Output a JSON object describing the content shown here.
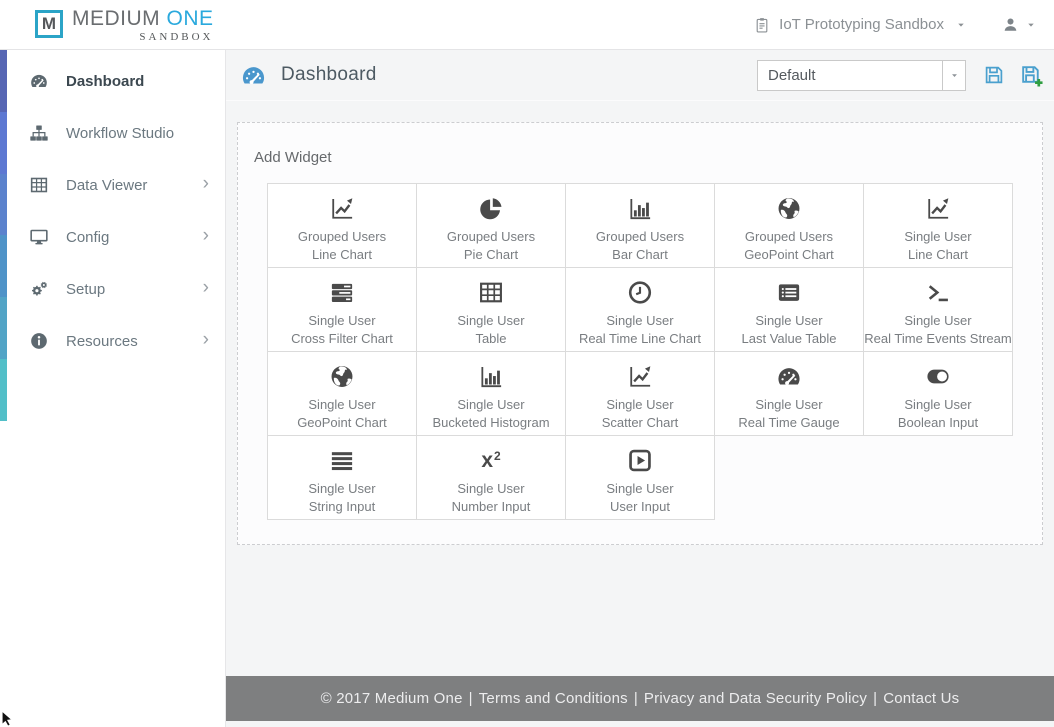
{
  "brand": {
    "mark": "M",
    "name_part1": "MEDIUM ",
    "name_part2": "ONE",
    "tagline": "SANDBOX"
  },
  "colors": {
    "brand_teal": "#2ba4c7",
    "brand_blue": "#2aa9dd",
    "header_icon_blue": "#4a97cd",
    "save_icon_blue": "#4aa0ce",
    "save_plus_green": "#2f9e41",
    "footer_bg": "#7e7f80",
    "sidebar_strip": [
      "#5766b4",
      "#5d78d2",
      "#5b82cd",
      "#4f93c8",
      "#52a4c6",
      "#52bfc8"
    ]
  },
  "top_bar": {
    "workspace_label": "IoT Prototyping Sandbox"
  },
  "sidebar": {
    "items": [
      {
        "label": "Dashboard",
        "icon": "gauge",
        "active": true,
        "chevron": false
      },
      {
        "label": "Workflow Studio",
        "icon": "sitemap",
        "active": false,
        "chevron": false
      },
      {
        "label": "Data Viewer",
        "icon": "table",
        "active": false,
        "chevron": true
      },
      {
        "label": "Config",
        "icon": "desktop",
        "active": false,
        "chevron": true
      },
      {
        "label": "Setup",
        "icon": "gears",
        "active": false,
        "chevron": true
      },
      {
        "label": "Resources",
        "icon": "info",
        "active": false,
        "chevron": true
      }
    ],
    "chevron_glyph": "›"
  },
  "main_header": {
    "title": "Dashboard",
    "preset_dropdown": {
      "value": "Default"
    }
  },
  "panel": {
    "title": "Add Widget",
    "widgets": [
      {
        "top": "Grouped Users",
        "bottom": "Line Chart",
        "icon": "line-chart"
      },
      {
        "top": "Grouped Users",
        "bottom": "Pie Chart",
        "icon": "pie-chart"
      },
      {
        "top": "Grouped Users",
        "bottom": "Bar Chart",
        "icon": "bar-chart"
      },
      {
        "top": "Grouped Users",
        "bottom": "GeoPoint Chart",
        "icon": "globe"
      },
      {
        "top": "Single User",
        "bottom": "Line Chart",
        "icon": "line-chart"
      },
      {
        "top": "Single User",
        "bottom": "Cross Filter Chart",
        "icon": "tasks"
      },
      {
        "top": "Single User",
        "bottom": "Table",
        "icon": "table-widget"
      },
      {
        "top": "Single User",
        "bottom": "Real Time Line Chart",
        "icon": "clock"
      },
      {
        "top": "Single User",
        "bottom": "Last Value Table",
        "icon": "list-alt"
      },
      {
        "top": "Single User",
        "bottom": "Real Time Events Stream",
        "icon": "terminal"
      },
      {
        "top": "Single User",
        "bottom": "GeoPoint Chart",
        "icon": "globe"
      },
      {
        "top": "Single User",
        "bottom": "Bucketed Histogram",
        "icon": "bar-chart"
      },
      {
        "top": "Single User",
        "bottom": "Scatter Chart",
        "icon": "line-chart"
      },
      {
        "top": "Single User",
        "bottom": "Real Time Gauge",
        "icon": "gauge"
      },
      {
        "top": "Single User",
        "bottom": "Boolean Input",
        "icon": "toggle"
      },
      {
        "top": "Single User",
        "bottom": "String Input",
        "icon": "align-justify"
      },
      {
        "top": "Single User",
        "bottom": "Number Input",
        "icon": "superscript"
      },
      {
        "top": "Single User",
        "bottom": "User Input",
        "icon": "play-square"
      }
    ]
  },
  "footer": {
    "copyright": "© 2017 Medium One",
    "links": [
      "Terms and Conditions",
      "Privacy and Data Security Policy",
      "Contact Us"
    ],
    "separator": "|"
  }
}
